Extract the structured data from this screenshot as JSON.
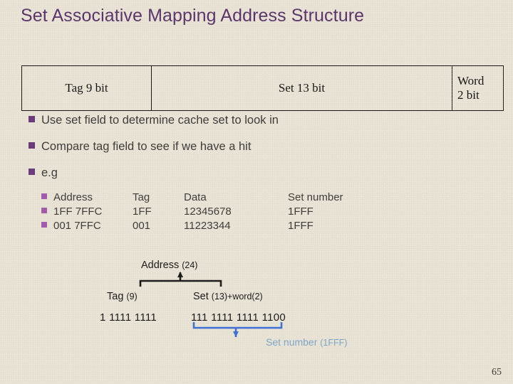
{
  "slide": {
    "title": "Set Associative Mapping Address Structure",
    "page_number": "65",
    "colors": {
      "background": "#e9e3d6",
      "title": "#59336a",
      "bullet": "#6b3a7a",
      "sub_bullet": "#a258ad",
      "body_text": "#3d3a38",
      "brace_black": "#191817",
      "brace_blue": "#3b6fd4",
      "set_number_label": "#7ba6c8"
    }
  },
  "address_structure": {
    "cells": [
      {
        "name": "tag",
        "label": "Tag  9 bit"
      },
      {
        "name": "set",
        "label": "Set  13 bit"
      },
      {
        "name": "word",
        "line1": "Word",
        "line2": "2 bit"
      }
    ]
  },
  "bullets": [
    {
      "text": "Use set field to determine cache set to look in"
    },
    {
      "text": "Compare tag field to see if we have a hit"
    },
    {
      "text": "e.g"
    }
  ],
  "example_table": {
    "headers": {
      "address": "Address",
      "tag": "Tag",
      "data": "Data",
      "set_number": "Set number"
    },
    "rows": [
      {
        "address": "1FF 7FFC",
        "tag": "1FF",
        "data": "12345678",
        "set_number": "1FFF"
      },
      {
        "address": "001 7FFC",
        "tag": "001",
        "data": "11223344",
        "set_number": "1FFF"
      }
    ]
  },
  "bit_diagram": {
    "address_label": "Address",
    "address_bits": "(24)",
    "tag_label": "Tag",
    "tag_bits": "(9)",
    "setword_label": "Set",
    "setword_bits": "(13)+word(2)",
    "tag_binary": "1 1111 1111",
    "set_binary": "111 1111 1111 1100",
    "set_number_label": "Set number",
    "set_number_value": "(1FFF)"
  }
}
